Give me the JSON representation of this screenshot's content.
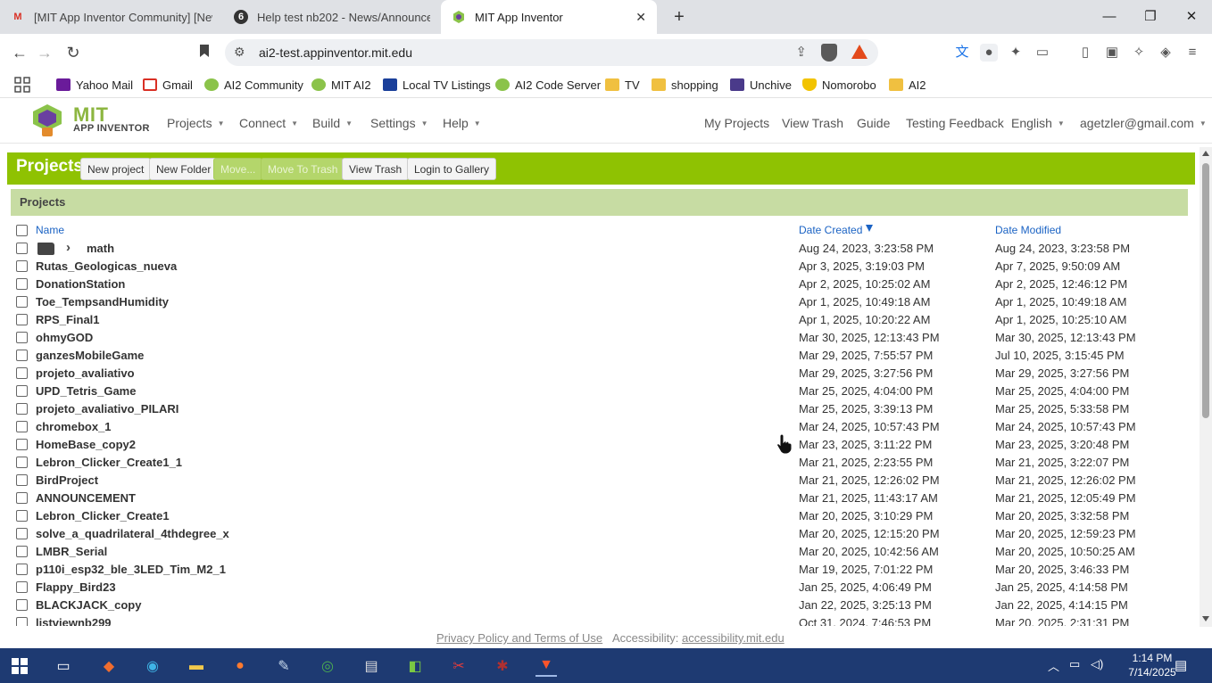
{
  "browser": {
    "tabs": [
      {
        "title": "[MIT App Inventor Community] [New",
        "favicon": "gmail-icon"
      },
      {
        "title": "Help test nb202 - News/Announceme",
        "favicon": "discourse-icon"
      },
      {
        "title": "MIT App Inventor",
        "favicon": "app-inventor-icon",
        "active": true
      }
    ],
    "url": "ai2-test.appinventor.mit.edu"
  },
  "bookmarks": [
    {
      "label": "Yahoo Mail",
      "icon": "yahoo-mail-icon"
    },
    {
      "label": "Gmail",
      "icon": "gmail-icon"
    },
    {
      "label": "AI2 Community",
      "icon": "ai2-icon"
    },
    {
      "label": "MIT AI2",
      "icon": "ai2-icon"
    },
    {
      "label": "Local TV Listings",
      "icon": "tv-icon"
    },
    {
      "label": "AI2 Code Server",
      "icon": "ai2-icon"
    },
    {
      "label": "TV",
      "icon": "folder-icon"
    },
    {
      "label": "shopping",
      "icon": "folder-icon"
    },
    {
      "label": "Unchive",
      "icon": "unchive-icon"
    },
    {
      "label": "Nomorobo",
      "icon": "nomorobo-icon"
    },
    {
      "label": "AI2",
      "icon": "folder-icon"
    }
  ],
  "app": {
    "logo_mit": "MIT",
    "logo_sub": "APP INVENTOR",
    "menus": [
      "Projects",
      "Connect",
      "Build",
      "Settings",
      "Help"
    ],
    "right_links": [
      "My Projects",
      "View Trash",
      "Guide",
      "Testing Feedback"
    ],
    "language": "English",
    "account": "agetzler@gmail.com"
  },
  "toolbar": {
    "title": "Projects",
    "new_project": "New project",
    "new_folder": "New Folder",
    "move": "Move...",
    "move_to_trash": "Move To Trash",
    "view_trash": "View Trash",
    "login_gallery": "Login to Gallery"
  },
  "table": {
    "panel_title": "Projects",
    "col_name": "Name",
    "col_created": "Date Created",
    "col_modified": "Date Modified",
    "rows": [
      {
        "name": "math",
        "created": "Aug 24, 2023, 3:23:58 PM",
        "modified": "Aug 24, 2023, 3:23:58 PM",
        "folder": true
      },
      {
        "name": "Rutas_Geologicas_nueva",
        "created": "Apr 3, 2025, 3:19:03 PM",
        "modified": "Apr 7, 2025, 9:50:09 AM"
      },
      {
        "name": "DonationStation",
        "created": "Apr 2, 2025, 10:25:02 AM",
        "modified": "Apr 2, 2025, 12:46:12 PM"
      },
      {
        "name": "Toe_TempsandHumidity",
        "created": "Apr 1, 2025, 10:49:18 AM",
        "modified": "Apr 1, 2025, 10:49:18 AM"
      },
      {
        "name": "RPS_Final1",
        "created": "Apr 1, 2025, 10:20:22 AM",
        "modified": "Apr 1, 2025, 10:25:10 AM"
      },
      {
        "name": "ohmyGOD",
        "created": "Mar 30, 2025, 12:13:43 PM",
        "modified": "Mar 30, 2025, 12:13:43 PM"
      },
      {
        "name": "ganzesMobileGame",
        "created": "Mar 29, 2025, 7:55:57 PM",
        "modified": "Jul 10, 2025, 3:15:45 PM"
      },
      {
        "name": "projeto_avaliativo",
        "created": "Mar 29, 2025, 3:27:56 PM",
        "modified": "Mar 29, 2025, 3:27:56 PM"
      },
      {
        "name": "UPD_Tetris_Game",
        "created": "Mar 25, 2025, 4:04:00 PM",
        "modified": "Mar 25, 2025, 4:04:00 PM"
      },
      {
        "name": "projeto_avaliativo_PILARI",
        "created": "Mar 25, 2025, 3:39:13 PM",
        "modified": "Mar 25, 2025, 5:33:58 PM"
      },
      {
        "name": "chromebox_1",
        "created": "Mar 24, 2025, 10:57:43 PM",
        "modified": "Mar 24, 2025, 10:57:43 PM"
      },
      {
        "name": "HomeBase_copy2",
        "created": "Mar 23, 2025, 3:11:22 PM",
        "modified": "Mar 23, 2025, 3:20:48 PM"
      },
      {
        "name": "Lebron_Clicker_Create1_1",
        "created": "Mar 21, 2025, 2:23:55 PM",
        "modified": "Mar 21, 2025, 3:22:07 PM"
      },
      {
        "name": "BirdProject",
        "created": "Mar 21, 2025, 12:26:02 PM",
        "modified": "Mar 21, 2025, 12:26:02 PM"
      },
      {
        "name": "ANNOUNCEMENT",
        "created": "Mar 21, 2025, 11:43:17 AM",
        "modified": "Mar 21, 2025, 12:05:49 PM"
      },
      {
        "name": "Lebron_Clicker_Create1",
        "created": "Mar 20, 2025, 3:10:29 PM",
        "modified": "Mar 20, 2025, 3:32:58 PM"
      },
      {
        "name": "solve_a_quadrilateral_4thdegree_x",
        "created": "Mar 20, 2025, 12:15:20 PM",
        "modified": "Mar 20, 2025, 12:59:23 PM"
      },
      {
        "name": "LMBR_Serial",
        "created": "Mar 20, 2025, 10:42:56 AM",
        "modified": "Mar 20, 2025, 10:50:25 AM"
      },
      {
        "name": "p110i_esp32_ble_3LED_Tim_M2_1",
        "created": "Mar 19, 2025, 7:01:22 PM",
        "modified": "Mar 20, 2025, 3:46:33 PM"
      },
      {
        "name": "Flappy_Bird23",
        "created": "Jan 25, 2025, 4:06:49 PM",
        "modified": "Jan 25, 2025, 4:14:58 PM"
      },
      {
        "name": "BLACKJACK_copy",
        "created": "Jan 22, 2025, 3:25:13 PM",
        "modified": "Jan 22, 2025, 4:14:15 PM"
      },
      {
        "name": "listviewnb299",
        "created": "Oct 31, 2024, 7:46:53 PM",
        "modified": "Mar 20, 2025, 2:31:31 PM"
      }
    ]
  },
  "footer": {
    "privacy": "Privacy Policy and Terms of Use",
    "accessibility_label": "Accessibility:",
    "accessibility_link": "accessibility.mit.edu"
  },
  "taskbar": {
    "time": "1:14 PM",
    "date": "7/14/2025"
  },
  "colors": {
    "accent_green": "#8fc202",
    "panel_header": "#c7dca3",
    "link_blue": "#1b63c4",
    "taskbar": "#1e3a72"
  }
}
